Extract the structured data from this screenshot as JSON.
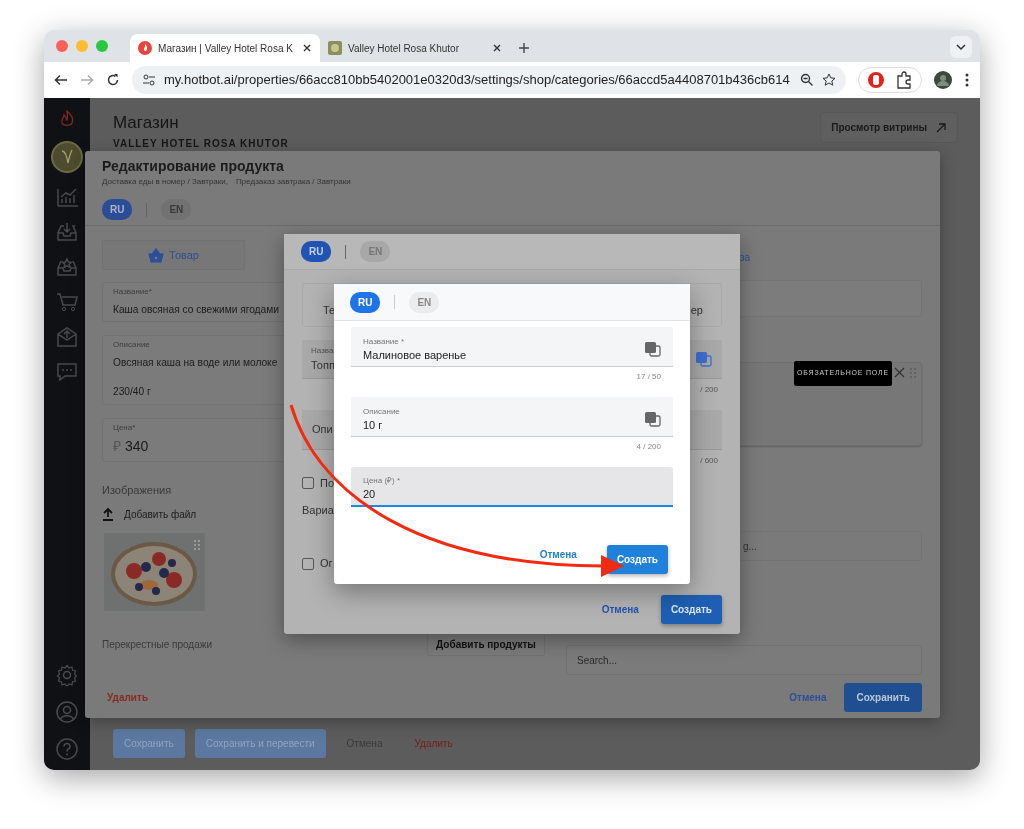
{
  "browser": {
    "tabs": [
      {
        "title": "Магазин | Valley Hotel Rosa K",
        "selected": true
      },
      {
        "title": "Valley Hotel Rosa Khutor",
        "selected": false
      }
    ],
    "url": "my.hotbot.ai/properties/66acc810bb5402001e0320d3/settings/shop/categories/66accd5a4408701b436cb614"
  },
  "page": {
    "title": "Магазин",
    "subtitle": "VALLEY HOTEL ROSA KHUTOR",
    "storefront_button": "Просмотр витрины",
    "footer_buttons": [
      {
        "label": "Сохранить",
        "kind": "primary"
      },
      {
        "label": "Сохранить и перевести",
        "kind": "primary"
      },
      {
        "label": "Отмена",
        "kind": "link"
      },
      {
        "label": "Удалить",
        "kind": "danger"
      }
    ]
  },
  "product_modal": {
    "title": "Редактирование продукта",
    "breadcrumbs": [
      "Доставка еды в номер / Завтраки,",
      "Предзаказ завтрака / Завтраки"
    ],
    "languages": [
      {
        "label": "RU",
        "selected": true
      },
      {
        "label": "EN",
        "selected": false
      }
    ],
    "tab": "Товар",
    "right_tab_fragment": "за",
    "name": {
      "label": "Название*",
      "value": "Каша овсяная со свежими ягодами"
    },
    "description": {
      "label": "Описание",
      "lines": [
        "Овсяная каша на воде или молоке",
        "230/40 г"
      ]
    },
    "price": {
      "label": "Цена*",
      "currency": "₽",
      "value": "340"
    },
    "images_label": "Изображения",
    "add_file": "Добавить файл",
    "cross_sell_label": "Перекрестные продажи",
    "add_products": "Добавить продукты",
    "right_field_fragment": "g...",
    "search": {
      "placeholder": "Search..."
    },
    "tooltip": "ОБЯЗАТЕЛЬНОЕ ПОЛЕ",
    "delete": "Удалить",
    "cancel": "Отмена",
    "save": "Сохранить"
  },
  "option_modal": {
    "languages": [
      {
        "label": "RU",
        "selected": true
      },
      {
        "label": "EN",
        "selected": false
      }
    ],
    "tab_fragments": [
      "Те",
      "ер"
    ],
    "name_label": "Назва",
    "name_value": "Топп",
    "name_counter": "/ 200",
    "description_label": "Опи",
    "description_counter": "/ 600",
    "checkboxes": [
      {
        "label": "По",
        "checked": false
      },
      {
        "label": "Ог",
        "checked": false
      }
    ],
    "variants_label": "Вариа",
    "cancel": "Отмена",
    "create": "Создать"
  },
  "value_dialog": {
    "languages": [
      {
        "label": "RU",
        "selected": true
      },
      {
        "label": "EN",
        "selected": false
      }
    ],
    "fields": [
      {
        "label": "Название *",
        "value": "Малиновое варенье",
        "counter": "17 / 50",
        "focused": false,
        "translatable": true
      },
      {
        "label": "Описание",
        "value": "10 г",
        "counter": "4 / 200",
        "focused": false,
        "translatable": true
      },
      {
        "label": "Цена (₽) *",
        "value": "20",
        "focused": true,
        "translatable": false
      }
    ],
    "cancel": "Отмена",
    "create": "Создать"
  }
}
